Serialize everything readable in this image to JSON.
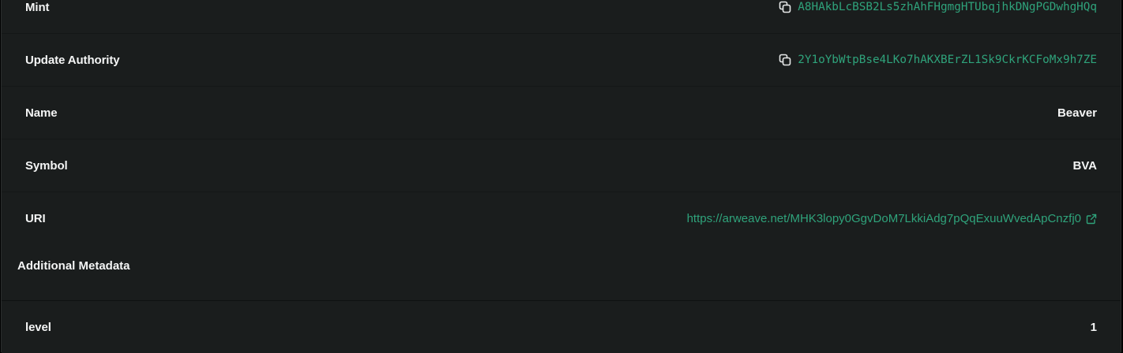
{
  "fields": {
    "mint": {
      "label": "Mint",
      "value": "A8HAkbLcBSB2Ls5zhAhFHgmgHTUbqjhkDNgPGDwhgHQq"
    },
    "update_authority": {
      "label": "Update Authority",
      "value": "2Y1oYbWtpBse4LKo7hAKXBErZL1Sk9CkrKCFoMx9h7ZE"
    },
    "name": {
      "label": "Name",
      "value": "Beaver"
    },
    "symbol": {
      "label": "Symbol",
      "value": "BVA"
    },
    "uri": {
      "label": "URI",
      "value": "https://arweave.net/MHK3lopy0GgvDoM7LkkiAdg7pQqExuuWvedApCnzfj0"
    }
  },
  "additional_metadata": {
    "title": "Additional Metadata",
    "items": [
      {
        "key": "level",
        "value": "1"
      }
    ]
  },
  "icons": {
    "copy": "copy-icon",
    "external": "external-link-icon"
  },
  "colors": {
    "background": "#1a1d1d",
    "accent": "#2fa37b",
    "text": "#f4f5f5"
  }
}
